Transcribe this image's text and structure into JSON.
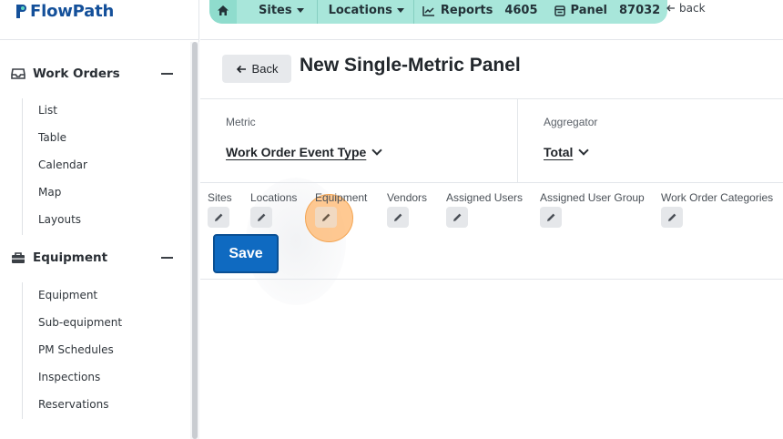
{
  "app": {
    "name": "FlowPath"
  },
  "colors": {
    "brand": "#14509a",
    "breadcrumb_bg": "#a8e6da",
    "primary": "#0f6ac1",
    "click_marker": "#ffb76e"
  },
  "sidebar": {
    "sections": [
      {
        "label": "Work Orders",
        "icon": "inbox-tray-icon",
        "items": [
          "List",
          "Table",
          "Calendar",
          "Map",
          "Layouts"
        ]
      },
      {
        "label": "Equipment",
        "icon": "toolbox-icon",
        "items": [
          "Equipment",
          "Sub-equipment",
          "PM Schedules",
          "Inspections",
          "Reservations"
        ]
      }
    ]
  },
  "breadcrumb": {
    "home_icon": "home-icon",
    "items": [
      {
        "label": "Sites",
        "dropdown": true
      },
      {
        "label": "Locations",
        "dropdown": true
      },
      {
        "label": "Reports",
        "icon": "line-chart-icon"
      },
      {
        "label": "4605"
      },
      {
        "label": "Panel",
        "icon": "panel-icon"
      },
      {
        "label": "87032"
      }
    ],
    "back_label": "back"
  },
  "page": {
    "back_button": "Back",
    "title": "New Single-Metric Panel"
  },
  "config": {
    "metric_label": "Metric",
    "metric_value": "Work Order Event Type",
    "aggregator_label": "Aggregator",
    "aggregator_value": "Total"
  },
  "filters": [
    "Sites",
    "Locations",
    "Equipment",
    "Vendors",
    "Assigned Users",
    "Assigned User Group",
    "Work Order Categories"
  ],
  "actions": {
    "save": "Save"
  }
}
